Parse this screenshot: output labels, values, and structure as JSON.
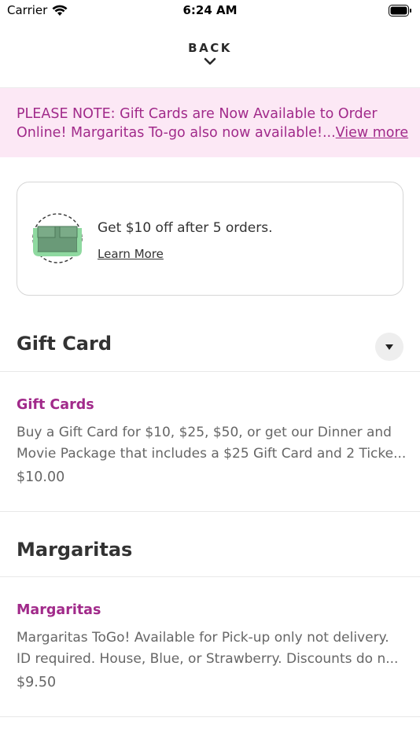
{
  "status_bar": {
    "carrier": "Carrier",
    "time": "6:24 AM"
  },
  "header": {
    "back_label": "BACK"
  },
  "notice": {
    "line1": "PLEASE NOTE: Gift Cards are Now Available to Order",
    "line2": "Online! Margaritas To-go also now available!...",
    "view_more": "View more"
  },
  "promo": {
    "text": "Get $10 off after 5 orders.",
    "link": "Learn More"
  },
  "sections": [
    {
      "title": "Gift Card",
      "items": [
        {
          "name": "Gift Cards",
          "desc_line1": "Buy a Gift Card for $10, $25, $50, or get our Dinner and",
          "desc_line2": "Movie Package that includes a $25 Gift Card and 2 Ticke...",
          "price": "$10.00"
        }
      ]
    },
    {
      "title": "Margaritas",
      "items": [
        {
          "name": "Margaritas",
          "desc_line1": "Margaritas ToGo! Available for Pick-up only not delivery.",
          "desc_line2": "ID required.  House, Blue, or Strawberry. Discounts do n...",
          "price": "$9.50"
        }
      ]
    }
  ],
  "colors": {
    "accent": "#a12a8a",
    "notice_bg": "#fce8f5",
    "promo_icon_green": "#8fd9a0"
  },
  "icons": {
    "wifi": "wifi-icon",
    "battery": "battery-icon",
    "back": "chevron-down-icon",
    "promo": "gift-box-icon",
    "collapse": "caret-down-icon"
  }
}
